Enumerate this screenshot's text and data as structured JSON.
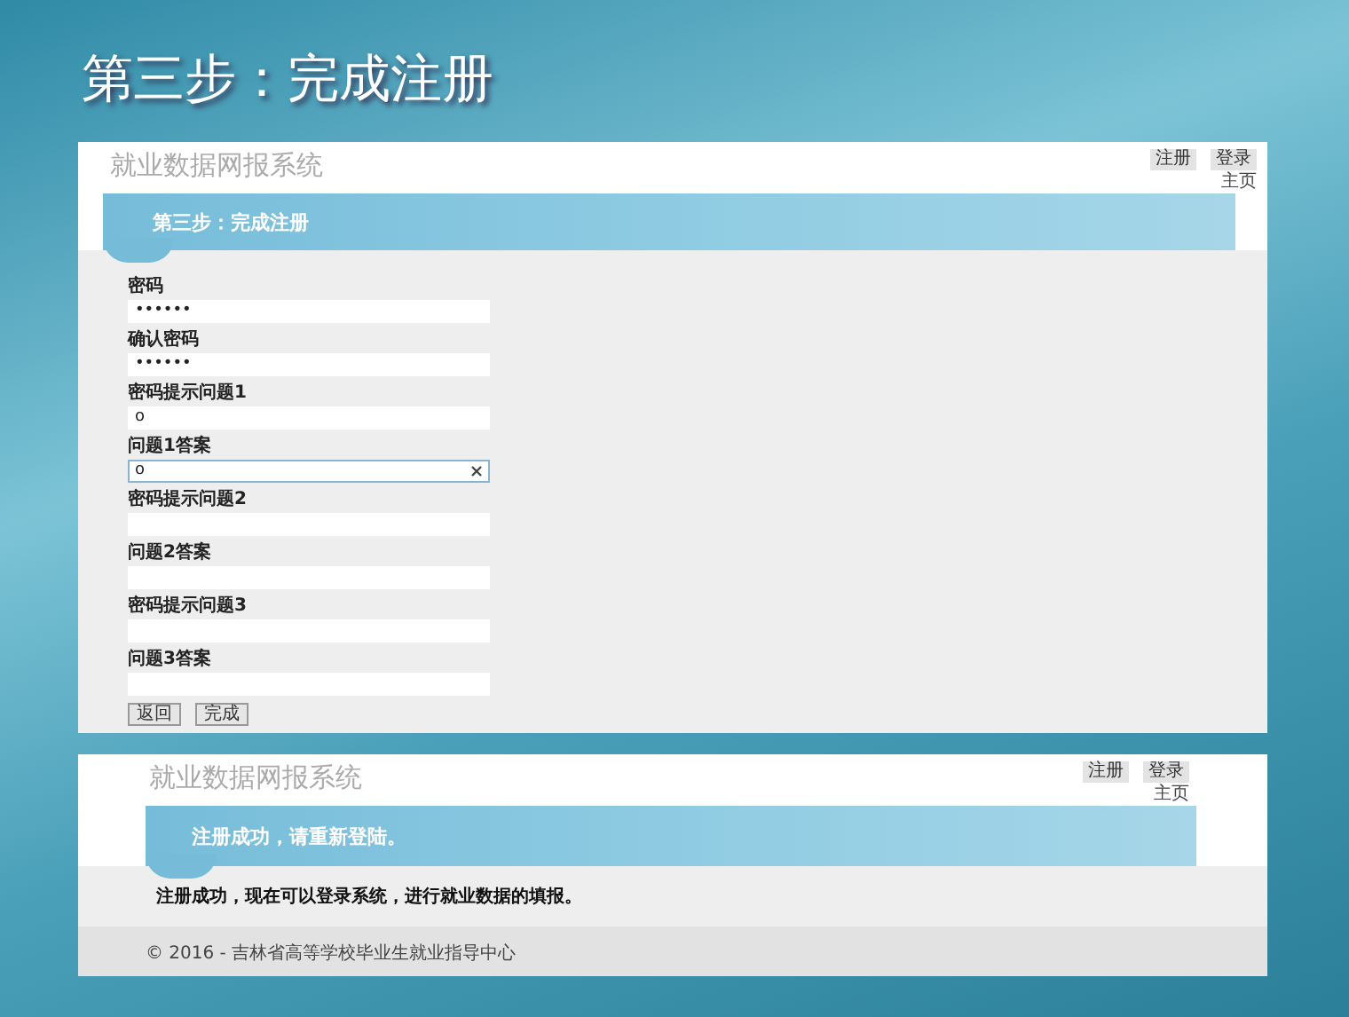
{
  "slide_title": "第三步：完成注册",
  "screens": [
    {
      "kind": "form",
      "site_title": "就业数据网报系统",
      "nav": [
        "注册",
        "登录"
      ],
      "home_link": "主页",
      "banner": "第三步：完成注册",
      "fields": [
        {
          "label": "密码",
          "value": "••••••",
          "focused": false
        },
        {
          "label": "确认密码",
          "value": "••••••",
          "focused": false
        },
        {
          "label": "密码提示问题1",
          "value": "o",
          "focused": false
        },
        {
          "label": "问题1答案",
          "value": "o",
          "focused": true
        },
        {
          "label": "密码提示问题2",
          "focused": false
        },
        {
          "label": "问题2答案",
          "focused": false
        },
        {
          "label": "密码提示问题3",
          "focused": false
        },
        {
          "label": "问题3答案",
          "focused": false
        }
      ],
      "buttons": [
        "返回",
        "完成"
      ]
    },
    {
      "kind": "message",
      "site_title": "就业数据网报系统",
      "nav": [
        "注册",
        "登录"
      ],
      "home_link": "主页",
      "banner": "注册成功，请重新登陆。",
      "message": "注册成功，现在可以登录系统，进行就业数据的填报。",
      "footer": "© 2016 - 吉林省高等学校毕业生就业指导中心"
    }
  ]
}
